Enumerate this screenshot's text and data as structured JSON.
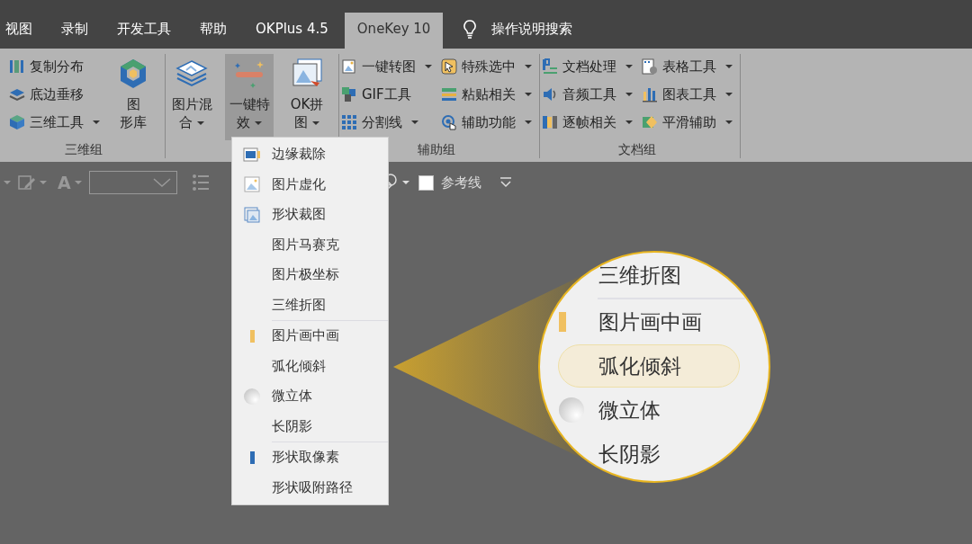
{
  "tabs": [
    {
      "label": "视图",
      "selected": false
    },
    {
      "label": "录制",
      "selected": false
    },
    {
      "label": "开发工具",
      "selected": false
    },
    {
      "label": "帮助",
      "selected": false
    },
    {
      "label": "OKPlus 4.5",
      "selected": false
    },
    {
      "label": "OneKey 10",
      "selected": true
    }
  ],
  "tell_me": {
    "placeholder": "操作说明搜索"
  },
  "ribbon": {
    "groups": [
      {
        "label": "三维组",
        "small_columns": [
          [
            {
              "label": "复制分布",
              "dropdown": false
            },
            {
              "label": "底边垂移",
              "dropdown": false
            },
            {
              "label": "三维工具",
              "dropdown": true
            }
          ]
        ],
        "big_buttons": [
          {
            "lines": [
              "图",
              "形库"
            ],
            "dropdown": false,
            "selected": false
          }
        ]
      },
      {
        "big_buttons": [
          {
            "lines": [
              "图片混",
              "合"
            ],
            "dropdown": true,
            "selected": false
          },
          {
            "lines": [
              "一键特",
              "效"
            ],
            "dropdown": true,
            "selected": true
          },
          {
            "lines": [
              "OK拼",
              "图"
            ],
            "dropdown": true,
            "selected": false
          }
        ]
      },
      {
        "label": "辅助组",
        "small_columns": [
          [
            {
              "label": "一键转图",
              "dropdown": true
            },
            {
              "label": "GIF工具",
              "dropdown": false
            },
            {
              "label": "分割线",
              "dropdown": true
            }
          ],
          [
            {
              "label": "特殊选中",
              "dropdown": true
            },
            {
              "label": "粘贴相关",
              "dropdown": true
            },
            {
              "label": "辅助功能",
              "dropdown": true
            }
          ]
        ]
      },
      {
        "label": "文档组",
        "small_columns": [
          [
            {
              "label": "文档处理",
              "dropdown": true
            },
            {
              "label": "音频工具",
              "dropdown": true
            },
            {
              "label": "逐帧相关",
              "dropdown": true
            }
          ],
          [
            {
              "label": "表格工具",
              "dropdown": true
            },
            {
              "label": "图表工具",
              "dropdown": true
            },
            {
              "label": "平滑辅助",
              "dropdown": true
            }
          ]
        ]
      }
    ]
  },
  "toolbar": {
    "font_color_label": "A",
    "reference_line": {
      "label": "参考线",
      "checked": false
    }
  },
  "menu": {
    "sections": [
      {
        "items": [
          "边缘裁除",
          "图片虚化",
          "形状裁图",
          "图片马赛克",
          "图片极坐标",
          "三维折图"
        ]
      },
      {
        "items": [
          "图片画中画",
          "弧化倾斜",
          "微立体",
          "长阴影"
        ]
      },
      {
        "items": [
          "形状取像素",
          "形状吸附路径"
        ]
      }
    ]
  },
  "magnifier": {
    "items": [
      {
        "label": "三维折图",
        "selected": false,
        "separator_after": true
      },
      {
        "label": "图片画中画",
        "selected": false,
        "separator_after": false
      },
      {
        "label": "弧化倾斜",
        "selected": true,
        "separator_after": false
      },
      {
        "label": "微立体",
        "selected": false,
        "separator_after": false
      },
      {
        "label": "长阴影",
        "selected": false,
        "separator_after": false
      }
    ]
  }
}
